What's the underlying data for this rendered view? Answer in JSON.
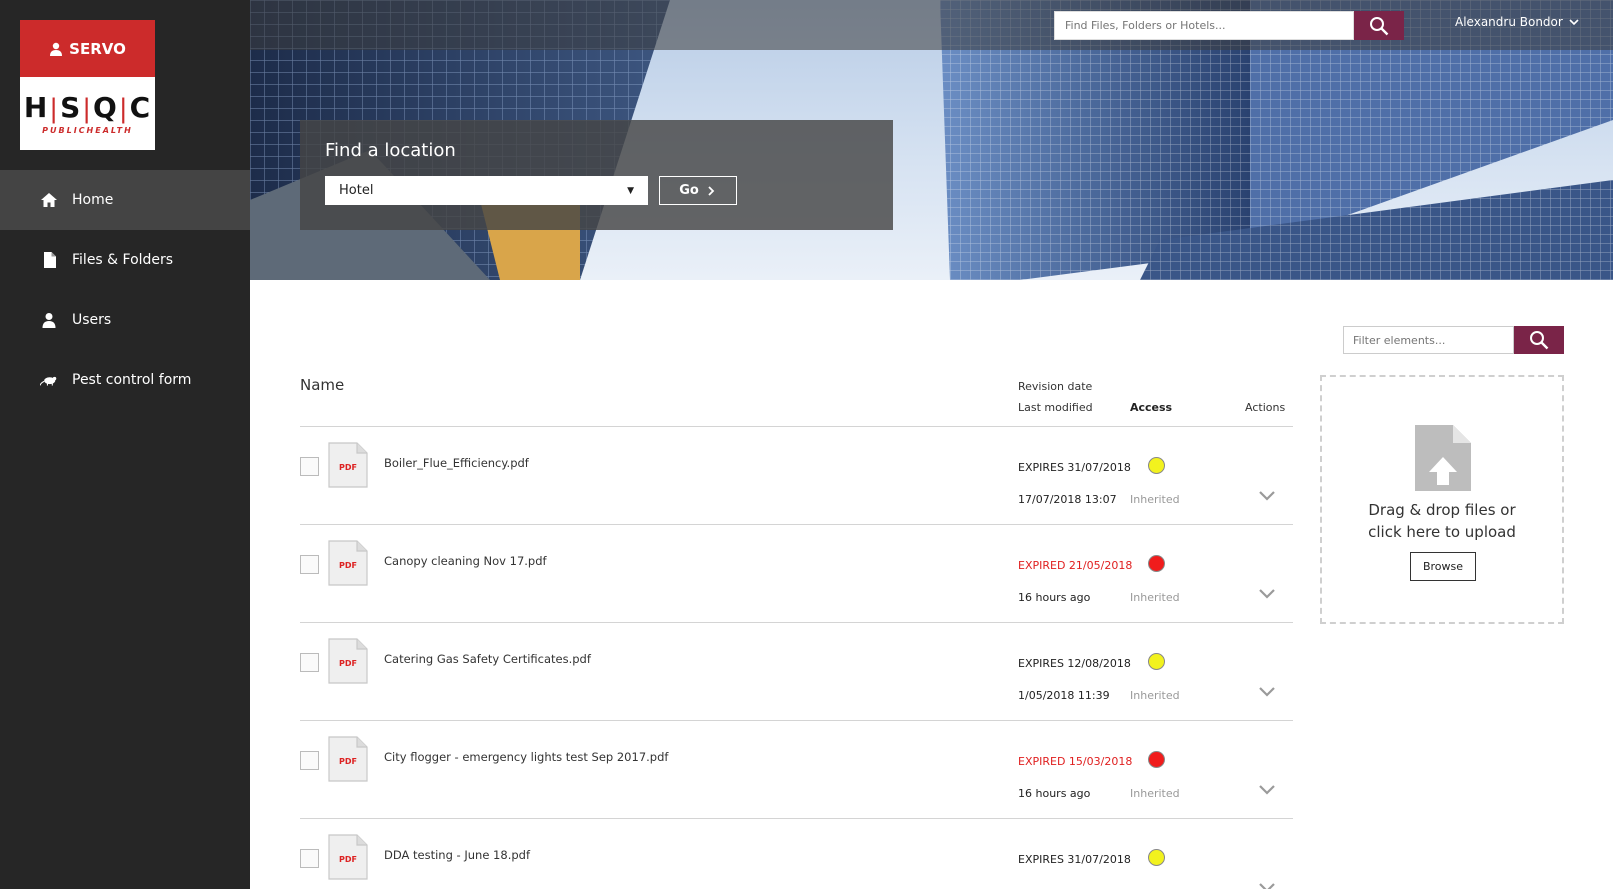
{
  "brand": {
    "top_label": "SERVO",
    "letters": [
      "H",
      "S",
      "Q",
      "C"
    ],
    "subtitle": "PUBLICHEALTH",
    "accent_color": "#cc2b2b"
  },
  "nav": {
    "items": [
      {
        "label": "Home",
        "icon": "home-icon",
        "active": true
      },
      {
        "label": "Files & Folders",
        "icon": "file-icon",
        "active": false
      },
      {
        "label": "Users",
        "icon": "user-icon",
        "active": false
      },
      {
        "label": "Pest control form",
        "icon": "rat-icon",
        "active": false
      }
    ]
  },
  "header": {
    "search_placeholder": "Find Files, Folders or Hotels...",
    "user_name": "Alexandru Bondor",
    "button_color": "#7a2448"
  },
  "find_location": {
    "title": "Find a location",
    "selected": "Hotel",
    "go_label": "Go"
  },
  "table": {
    "col_name": "Name",
    "col_revision": "Revision date",
    "col_modified": "Last modified",
    "col_access": "Access",
    "col_actions": "Actions",
    "rows": [
      {
        "name": "Boiler_Flue_Efficiency.pdf",
        "expiry": "EXPIRES 31/07/2018",
        "expired": false,
        "status_color": "#f2f21e",
        "modified": "17/07/2018 13:07",
        "access": "Inherited",
        "badge": "PDF"
      },
      {
        "name": "Canopy cleaning Nov 17.pdf",
        "expiry": "EXPIRED 21/05/2018",
        "expired": true,
        "status_color": "#f01c1c",
        "modified": "16 hours ago",
        "access": "Inherited",
        "badge": "PDF"
      },
      {
        "name": "Catering Gas Safety Certificates.pdf",
        "expiry": "EXPIRES 12/08/2018",
        "expired": false,
        "status_color": "#f2f21e",
        "modified": "1/05/2018 11:39",
        "access": "Inherited",
        "badge": "PDF"
      },
      {
        "name": "City flogger - emergency lights test Sep 2017.pdf",
        "expiry": "EXPIRED 15/03/2018",
        "expired": true,
        "status_color": "#f01c1c",
        "modified": "16 hours ago",
        "access": "Inherited",
        "badge": "PDF"
      },
      {
        "name": "DDA testing - June 18.pdf",
        "expiry": "EXPIRES 31/07/2018",
        "expired": false,
        "status_color": "#f2f21e",
        "modified": "",
        "access": "",
        "badge": "PDF"
      }
    ]
  },
  "upload": {
    "filter_placeholder": "Filter elements...",
    "drop_line1": "Drag & drop files or",
    "drop_line2": "click here to upload",
    "browse_label": "Browse"
  }
}
